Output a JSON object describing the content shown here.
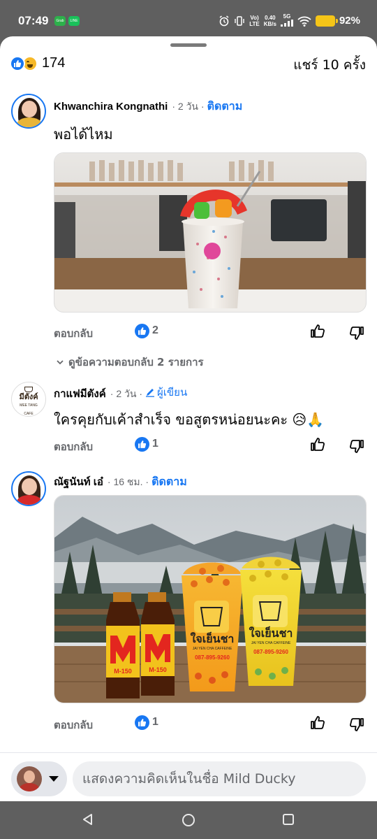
{
  "status_bar": {
    "time": "07:49",
    "app_icons": [
      {
        "name": "grab-icon",
        "label": "Grab",
        "color": "#2db04b"
      },
      {
        "name": "line-icon",
        "label": "LINE",
        "color": "#19c15a"
      }
    ],
    "net_top": "Vo)",
    "net_bottom": "LTE",
    "speed_top": "0.40",
    "speed_bottom": "KB/s",
    "net_5g": "5G",
    "battery": "92%"
  },
  "post_summary": {
    "reaction_count": "174",
    "shares": "แชร์ 10 ครั้ง"
  },
  "comments": [
    {
      "author": "Khwanchira Kongnathi",
      "time": "· 2 วัน ·",
      "follow": "ติดตาม",
      "text": "พอได้ไหม",
      "reply": "ตอบกลับ",
      "likes": "2",
      "view_replies": "ดูข้อความตอบกลับ 2 รายการ"
    },
    {
      "author": "กาแฟมีตังค์",
      "time": "· 2 วัน ·",
      "author_badge": "ผู้เขียน",
      "text": "ใครคุยกับเค้าสำเร็จ ขอสูตรหน่อยนะคะ 😥🙏",
      "reply": "ตอบกลับ",
      "likes": "1",
      "logo_text": "มีตังค์",
      "logo_sub": "MEE TANG CAFE"
    },
    {
      "author": "ณัฐนันท์ เอ๋",
      "time": "· 16 ชม. ·",
      "follow": "ติดตาม",
      "reply": "ตอบกลับ",
      "likes": "1",
      "bottle_label": "M-150",
      "cup_brand": "ใจเย็นชา",
      "cup_sub": "JAI YEN CHA CAFFEINE",
      "cup_phone": "087-895-9260"
    }
  ],
  "composer": {
    "placeholder": "แสดงความคิดเห็นในชื่อ Mild Ducky"
  },
  "colors": {
    "accent": "#1877f2",
    "muted_text": "#65676b",
    "system_bar": "#5f5f5f",
    "battery": "#f5c518"
  }
}
